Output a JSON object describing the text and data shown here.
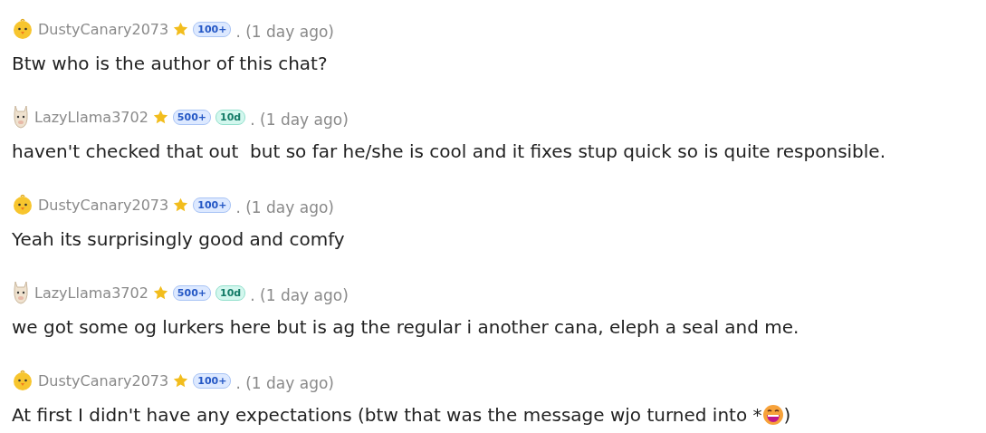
{
  "messages": [
    {
      "user": {
        "kind": "chick",
        "name": "DustyCanary2073",
        "badges": [
          {
            "kind": "count",
            "text": "100+"
          }
        ]
      },
      "time": ". (1 day ago)",
      "parts": [
        {
          "kind": "text",
          "text": "Btw who is the author of this chat?"
        }
      ]
    },
    {
      "user": {
        "kind": "llama",
        "name": "LazyLlama3702",
        "badges": [
          {
            "kind": "count",
            "text": "500+"
          },
          {
            "kind": "days",
            "text": "10d"
          }
        ]
      },
      "time": ". (1 day ago)",
      "parts": [
        {
          "kind": "text",
          "text": "haven't checked that out  but so far he/she is cool and it fixes stup quick so is quite responsible."
        }
      ]
    },
    {
      "user": {
        "kind": "chick",
        "name": "DustyCanary2073",
        "badges": [
          {
            "kind": "count",
            "text": "100+"
          }
        ]
      },
      "time": ". (1 day ago)",
      "parts": [
        {
          "kind": "text",
          "text": "Yeah its surprisingly good and comfy"
        }
      ]
    },
    {
      "user": {
        "kind": "llama",
        "name": "LazyLlama3702",
        "badges": [
          {
            "kind": "count",
            "text": "500+"
          },
          {
            "kind": "days",
            "text": "10d"
          }
        ]
      },
      "time": ". (1 day ago)",
      "parts": [
        {
          "kind": "text",
          "text": "we got some og lurkers here but is ag the regular i another cana, eleph a seal and me."
        }
      ]
    },
    {
      "user": {
        "kind": "chick",
        "name": "DustyCanary2073",
        "badges": [
          {
            "kind": "count",
            "text": "100+"
          }
        ]
      },
      "time": ". (1 day ago)",
      "parts": [
        {
          "kind": "text",
          "text": "At first I didn't have any expectations (btw that was the message wjo turned into *"
        },
        {
          "kind": "emoji"
        },
        {
          "kind": "text",
          "text": ")"
        }
      ]
    }
  ]
}
